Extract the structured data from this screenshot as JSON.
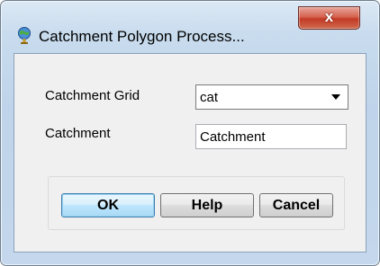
{
  "window": {
    "title": "Catchment Polygon Process...",
    "close_label": "x"
  },
  "form": {
    "catchment_grid_label": "Catchment Grid",
    "catchment_grid_value": "cat",
    "catchment_label": "Catchment",
    "catchment_value": "Catchment"
  },
  "buttons": {
    "ok": "OK",
    "help": "Help",
    "cancel": "Cancel"
  },
  "icons": {
    "title": "globe-icon",
    "dropdown": "chevron-down-icon"
  },
  "colors": {
    "frame": "#c4d7ec",
    "close_button": "#c33b26",
    "default_button_border": "#3c7fb1"
  }
}
